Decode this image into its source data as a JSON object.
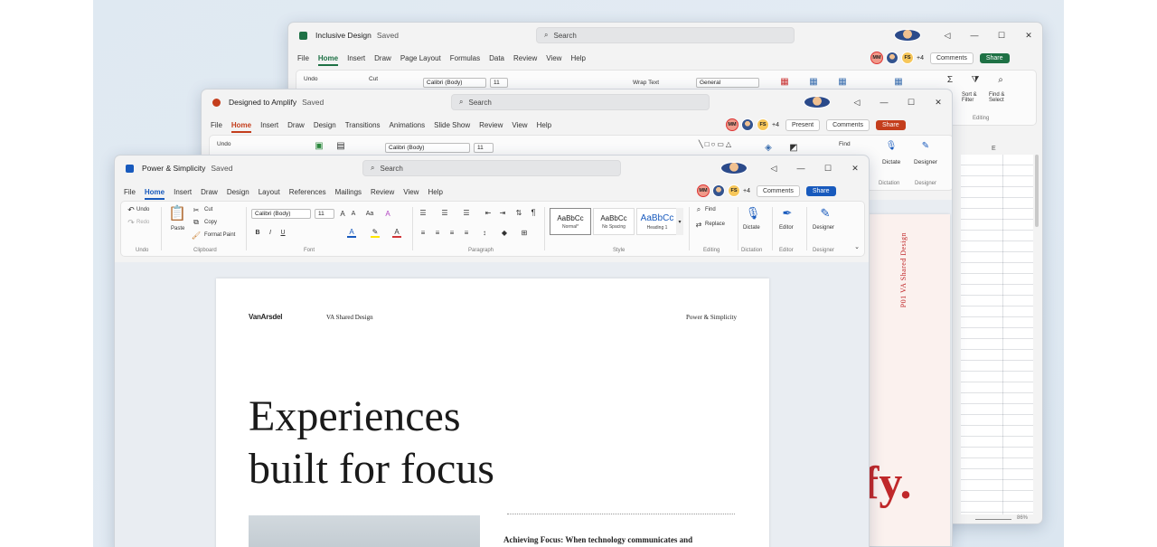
{
  "excel": {
    "title": "Inclusive Design",
    "saved": "Saved",
    "search": "Search",
    "menu": [
      "File",
      "Home",
      "Insert",
      "Draw",
      "Page Layout",
      "Formulas",
      "Data",
      "Review",
      "View",
      "Help"
    ],
    "collab": {
      "a1": "MM",
      "a2": "",
      "a3": "FS",
      "more": "+4",
      "comments": "Comments",
      "share": "Share"
    },
    "ribbon": {
      "undo": "Undo",
      "cut": "Cut",
      "font": "Calibri (Body)",
      "size": "11",
      "wrap": "Wrap Text",
      "format": "General",
      "sort": "Sort & Filter",
      "find": "Find & Select",
      "editing": "Editing"
    },
    "col_e": "E",
    "zoom": "86%",
    "colors": {
      "brand": "#1e7145",
      "share": "#1e7145"
    }
  },
  "ppt": {
    "title": "Designed to Amplify",
    "saved": "Saved",
    "search": "Search",
    "menu": [
      "File",
      "Home",
      "Insert",
      "Draw",
      "Design",
      "Transitions",
      "Animations",
      "Slide Show",
      "Review",
      "View",
      "Help"
    ],
    "collab": {
      "a1": "MM",
      "a2": "",
      "a3": "FS",
      "more": "+4",
      "present": "Present",
      "comments": "Comments",
      "share": "Share"
    },
    "ribbon": {
      "undo": "Undo",
      "font": "Calibri (Body)",
      "size": "11",
      "find": "Find",
      "dictate": "Dictate",
      "designer": "Designer",
      "voice": "Dictation",
      "designer_group": "Designer"
    },
    "slide_vertical": "P01  VA Shared Design",
    "slide_big": "fy.",
    "colors": {
      "brand": "#c43e1c",
      "share": "#c43e1c"
    }
  },
  "word": {
    "title": "Power & Simplicity",
    "saved": "Saved",
    "search": "Search",
    "menu": [
      "File",
      "Home",
      "Insert",
      "Draw",
      "Design",
      "Layout",
      "References",
      "Mailings",
      "Review",
      "View",
      "Help"
    ],
    "collab": {
      "a1": "MM",
      "a2": "",
      "a3": "FS",
      "more": "+4",
      "comments": "Comments",
      "share": "Share"
    },
    "ribbon": {
      "undo": "Undo",
      "redo": "Redo",
      "undo_group": "Undo",
      "paste": "Paste",
      "cut": "Cut",
      "copy": "Copy",
      "format_painter": "Format Paint",
      "clipboard": "Clipboard",
      "font": "Calibri (Body)",
      "size": "11",
      "font_group": "Font",
      "paragraph": "Paragraph",
      "styles": [
        {
          "preview": "AaBbCc",
          "name": "Normal*"
        },
        {
          "preview": "AaBbCc",
          "name": "No Spacing"
        },
        {
          "preview": "AaBbCc",
          "name": "Heading 1"
        }
      ],
      "style_group": "Style",
      "find": "Find",
      "replace": "Replace",
      "editing": "Editing",
      "dictate": "Dictate",
      "dictation": "Dictation",
      "editor": "Editor",
      "editor_group": "Editor",
      "designer": "Designer",
      "designer_group": "Designer"
    },
    "doc": {
      "logo": "VanArsdel",
      "header_mid": "VA Shared Design",
      "header_right": "Power & Simplicity",
      "headline1": "Experiences",
      "headline2": "built for focus",
      "sub": "Achieving Focus: When technology communicates and"
    },
    "colors": {
      "brand": "#185abd",
      "share": "#185abd"
    }
  }
}
